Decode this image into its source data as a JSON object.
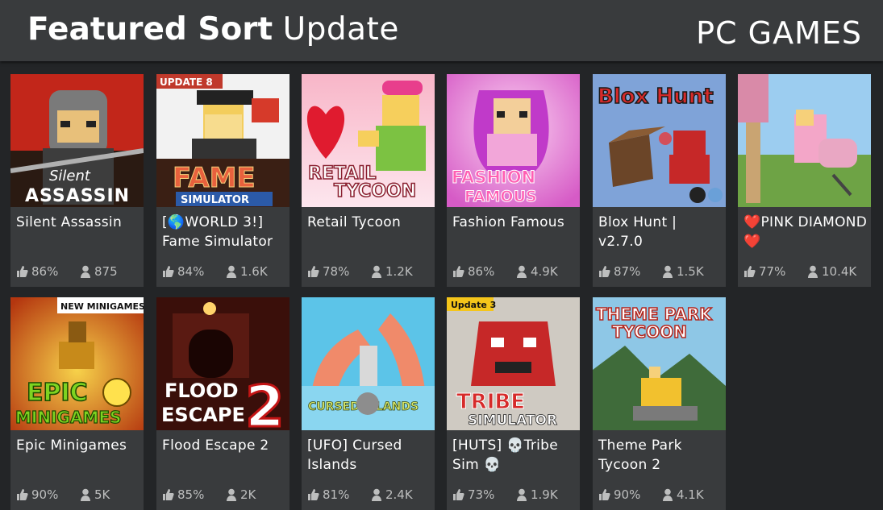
{
  "header": {
    "title_bold": "Featured Sort",
    "title_light": "Update",
    "platform": "PC GAMES"
  },
  "games": [
    {
      "name": "Silent Assassin",
      "votes": "86%",
      "players": "875",
      "thumb_text": "Silent\nASSASSIN",
      "icon": "silent-assassin-thumbnail"
    },
    {
      "name": "[🌎WORLD 3!] Fame Simulator",
      "votes": "84%",
      "players": "1.6K",
      "thumb_text": "FAME\nSIMULATOR",
      "badge": "UPDATE 8",
      "icon": "fame-simulator-thumbnail"
    },
    {
      "name": "Retail Tycoon",
      "votes": "78%",
      "players": "1.2K",
      "thumb_text": "RETAIL\nTYCOON",
      "icon": "retail-tycoon-thumbnail"
    },
    {
      "name": "Fashion Famous",
      "votes": "86%",
      "players": "4.9K",
      "thumb_text": "FASHION\nFAMOUS",
      "icon": "fashion-famous-thumbnail"
    },
    {
      "name": "Blox Hunt | v2.7.0",
      "votes": "87%",
      "players": "1.5K",
      "thumb_text": "Blox Hunt",
      "icon": "blox-hunt-thumbnail"
    },
    {
      "name": "❤️PINK DIAMOND❤️",
      "votes": "77%",
      "players": "10.4K",
      "icon": "pink-diamond-thumbnail"
    },
    {
      "name": "Epic Minigames",
      "votes": "90%",
      "players": "5K",
      "thumb_text": "EPIC\nMINIGAMES",
      "badge": "NEW MINIGAMES",
      "icon": "epic-minigames-thumbnail"
    },
    {
      "name": "Flood Escape 2",
      "votes": "85%",
      "players": "2K",
      "thumb_text": "FLOOD\nESCAPE",
      "icon": "flood-escape-thumbnail"
    },
    {
      "name": "[UFO] Cursed Islands",
      "votes": "81%",
      "players": "2.4K",
      "thumb_text": "CURSED ISLANDS",
      "icon": "cursed-islands-thumbnail"
    },
    {
      "name": "[HUTS] 💀Tribe Sim 💀",
      "votes": "73%",
      "players": "1.9K",
      "thumb_text": "TRIBE\nSIMULATOR",
      "badge": "Update 3",
      "icon": "tribe-sim-thumbnail"
    },
    {
      "name": "Theme Park Tycoon 2",
      "votes": "90%",
      "players": "4.1K",
      "thumb_text": "THEME PARK\nTYCOON",
      "icon": "theme-park-tycoon-thumbnail"
    }
  ],
  "colors": {
    "background": "#232527",
    "card": "#393b3d",
    "stat_text": "#bdbebe"
  }
}
